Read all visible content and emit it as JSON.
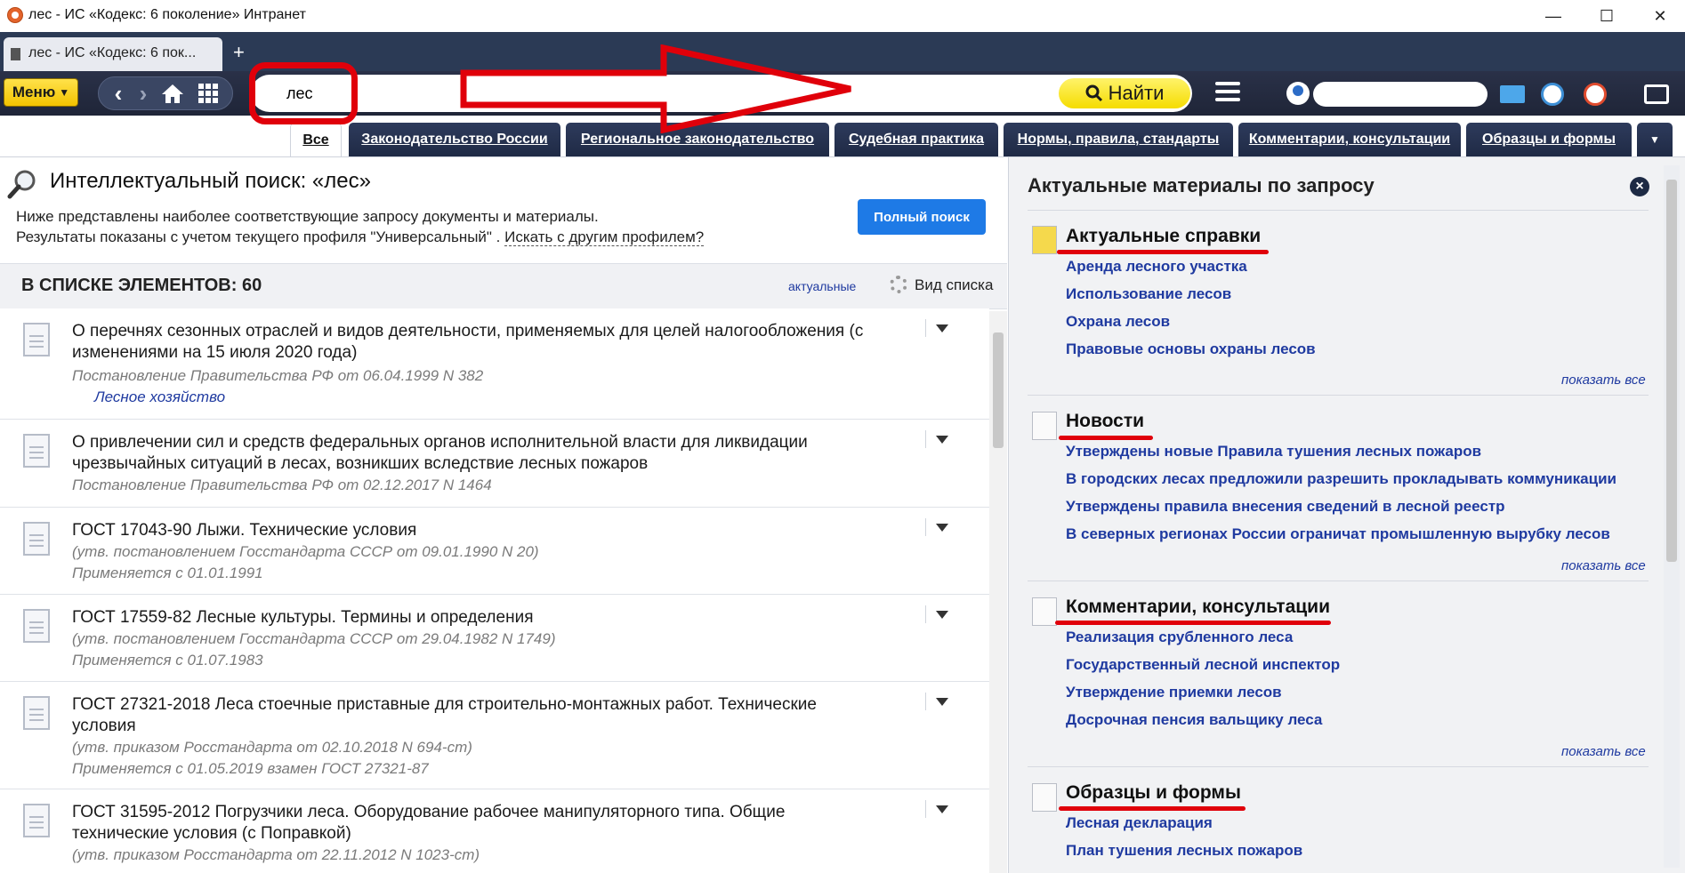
{
  "window": {
    "title": "лес - ИС «Кодекс: 6 поколение» Интранет",
    "minimize": "—",
    "maximize": "☐",
    "close": "✕"
  },
  "browser_tab": {
    "label": "лес - ИС «Кодекс: 6 пок...",
    "new_tab": "+"
  },
  "toolbar": {
    "menu_label": "Меню",
    "back": "‹",
    "forward": "›",
    "search_value": "лес",
    "find_label": "Найти"
  },
  "category_tabs": [
    "Все",
    "Законодательство России",
    "Региональное законодательство",
    "Судебная практика",
    "Нормы, правила, стандарты",
    "Комментарии, консультации",
    "Образцы и формы"
  ],
  "search": {
    "title": "Интеллектуальный поиск: «лес»",
    "description1": "Ниже представлены наиболее соответствующие запросу документы и материалы.",
    "description2_prefix": "Результаты показаны с учетом текущего профиля \"Универсальный\" . ",
    "description2_link": "Искать с другим профилем?",
    "full_search_label": "Полный поиск"
  },
  "list": {
    "count_label": "В СПИСКЕ ЭЛЕМЕНТОВ: 60",
    "actual_link": "актуальные",
    "view_label": "Вид списка",
    "documents": [
      {
        "title": "О перечнях сезонных отраслей и видов деятельности, применяемых для целей налогообложения (с изменениями на 15 июля 2020 года)",
        "meta1": "Постановление Правительства РФ от 06.04.1999 N 382",
        "tag": "Лесное хозяйство"
      },
      {
        "title": "О привлечении сил и средств федеральных органов исполнительной власти для ликвидации чрезвычайных ситуаций в лесах, возникших вследствие лесных пожаров",
        "meta1": "Постановление Правительства РФ от 02.12.2017 N 1464"
      },
      {
        "title": "ГОСТ 17043-90 Лыжи. Технические условия",
        "meta1": "(утв. постановлением Госстандарта СССР от 09.01.1990 N 20)",
        "meta2": "Применяется с 01.01.1991"
      },
      {
        "title": "ГОСТ 17559-82 Лесные культуры. Термины и определения",
        "meta1": "(утв. постановлением Госстандарта СССР от 29.04.1982 N 1749)",
        "meta2": "Применяется с 01.07.1983"
      },
      {
        "title": "ГОСТ 27321-2018 Леса стоечные приставные для строительно-монтажных работ. Технические условия",
        "meta1": "(утв. приказом Росстандарта от 02.10.2018 N 694-ст)",
        "meta2": "Применяется с 01.05.2019 взамен ГОСТ 27321-87"
      },
      {
        "title": "ГОСТ 31595-2012 Погрузчики леса. Оборудование рабочее манипуляторного типа. Общие технические условия (с Поправкой)",
        "meta1": "(утв. приказом Росстандарта от 22.11.2012 N 1023-ст)"
      }
    ]
  },
  "right_panel": {
    "title": "Актуальные материалы по запросу",
    "show_all": "показать все",
    "sections": [
      {
        "title": "Актуальные справки",
        "items": [
          "Аренда лесного участка",
          "Использование лесов",
          "Охрана лесов",
          "Правовые основы охраны лесов"
        ]
      },
      {
        "title": "Новости",
        "items": [
          "Утверждены новые Правила тушения лесных пожаров",
          "В городских лесах предложили разрешить прокладывать коммуникации",
          "Утверждены правила внесения сведений в лесной реестр",
          "В северных регионах России ограничат промышленную вырубку лесов"
        ]
      },
      {
        "title": "Комментарии, консультации",
        "items": [
          "Реализация срубленного леса",
          "Государственный лесной инспектор",
          "Утверждение приемки лесов",
          "Досрочная пенсия вальщику леса"
        ]
      },
      {
        "title": "Образцы и формы",
        "items": [
          "Лесная декларация",
          "План тушения лесных пожаров"
        ]
      }
    ]
  },
  "colors": {
    "annotation": "#e0000a",
    "accent": "#1e7ae6",
    "menu": "#f3c300",
    "link": "#1f3aa0"
  }
}
